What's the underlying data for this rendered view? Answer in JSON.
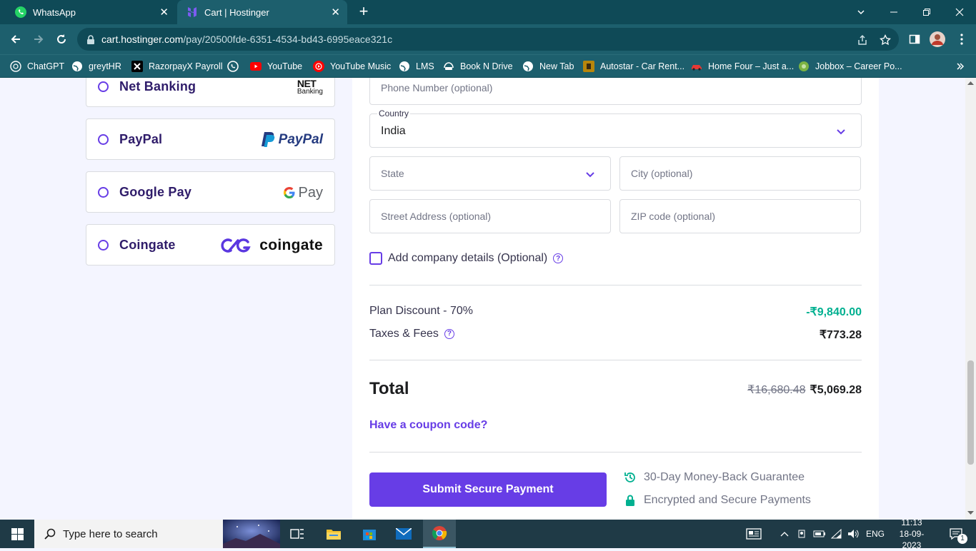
{
  "browser": {
    "tabs": [
      {
        "title": "WhatsApp",
        "active": false,
        "icon": "whatsapp-icon"
      },
      {
        "title": "Cart | Hostinger",
        "active": true,
        "icon": "hostinger-icon"
      }
    ],
    "url_host": "cart.hostinger.com",
    "url_path": "/pay/20500fde-6351-4534-bd43-6995eace321c",
    "bookmarks": [
      {
        "label": "ChatGPT",
        "icon": "chatgpt-icon"
      },
      {
        "label": "greytHR",
        "icon": "globe-icon"
      },
      {
        "label": "RazorpayX Payroll",
        "icon": "razorpayx-icon"
      },
      {
        "label": "",
        "icon": "whatsapp-icon"
      },
      {
        "label": "YouTube",
        "icon": "youtube-icon"
      },
      {
        "label": "YouTube Music",
        "icon": "youtube-music-icon"
      },
      {
        "label": "LMS",
        "icon": "globe-icon"
      },
      {
        "label": "Book N Drive",
        "icon": "booknDrive-icon"
      },
      {
        "label": "New Tab",
        "icon": "globe-icon"
      },
      {
        "label": "Autostar - Car Rent...",
        "icon": "autostar-icon"
      },
      {
        "label": "Home Four – Just a...",
        "icon": "car-icon"
      },
      {
        "label": "Jobbox – Career Po...",
        "icon": "jobbox-icon"
      }
    ]
  },
  "payment_methods": [
    {
      "label": "Net Banking",
      "logo_top": "NET",
      "logo_bottom": "Banking"
    },
    {
      "label": "PayPal",
      "logo_text": "PayPal"
    },
    {
      "label": "Google Pay",
      "logo_text": "Pay"
    },
    {
      "label": "Coingate",
      "logo_text": "coingate"
    }
  ],
  "form": {
    "phone_placeholder": "Phone Number (optional)",
    "country_label": "Country",
    "country_value": "India",
    "state_placeholder": "State",
    "city_placeholder": "City (optional)",
    "street_placeholder": "Street Address (optional)",
    "zip_placeholder": "ZIP code (optional)",
    "company_checkbox_label": "Add company details (Optional)"
  },
  "summary": {
    "discount_label": "Plan Discount - 70%",
    "discount_value": "-₹9,840.00",
    "taxes_label": "Taxes & Fees",
    "taxes_value": "₹773.28",
    "total_label": "Total",
    "total_original": "₹16,680.48",
    "total_final": "₹5,069.28",
    "coupon_link": "Have a coupon code?",
    "submit_label": "Submit Secure Payment",
    "guarantee_1": "30-Day Money-Back Guarantee",
    "guarantee_2": "Encrypted and Secure Payments"
  },
  "colors": {
    "accent": "#673de6",
    "discount": "#00b090",
    "chrome_dark": "#0f4a57",
    "chrome_light": "#1d5f6d"
  },
  "taskbar": {
    "search_placeholder": "Type here to search",
    "language": "ENG",
    "time": "11:13",
    "date": "18-09-2023",
    "notifications_count": "1"
  }
}
